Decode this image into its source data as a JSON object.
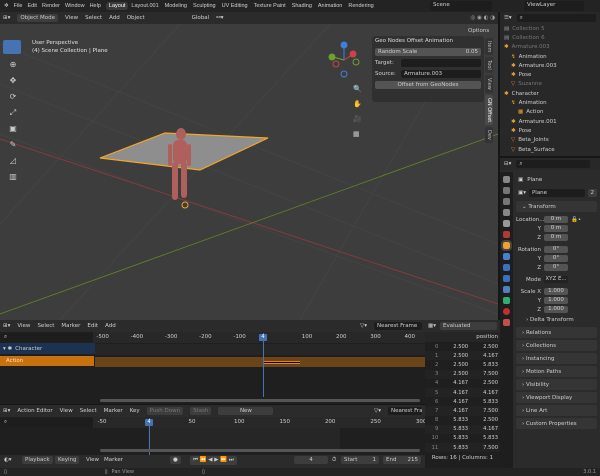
{
  "menu": {
    "items": [
      "File",
      "Edit",
      "Render",
      "Window",
      "Help"
    ],
    "workspaces": [
      "Layout",
      "Layout.001",
      "Modeling",
      "Sculpting",
      "UV Editing",
      "Texture Paint",
      "Shading",
      "Animation",
      "Rendering"
    ],
    "active": "Layout",
    "scene": "Scene",
    "view_layer": "ViewLayer"
  },
  "viewport": {
    "mode": "Object Mode",
    "menus": [
      "View",
      "Select",
      "Add",
      "Object"
    ],
    "orientation": "Global",
    "options": "Options",
    "info_line1": "User Perspective",
    "info_line2": "(4) Scene Collection | Plane",
    "gizmo_axes": [
      "Z",
      "Y",
      "X"
    ]
  },
  "npanel": {
    "title": "Geo Nodes Offset Animation",
    "field_label": "Random Scale",
    "field_value": "0.05",
    "target_label": "Target:",
    "target_value": "",
    "source_label": "Source:",
    "source_value": "Armature.003",
    "button": "Offset from GeoNodes",
    "tabs": [
      "Item",
      "Tool",
      "View",
      "GN Offset",
      "Dev"
    ],
    "active_tab": "GN Offset"
  },
  "outliner": {
    "items": [
      {
        "label": "Collection 5",
        "indent": 0,
        "dim": true
      },
      {
        "label": "Collection 6",
        "indent": 0,
        "dim": true
      },
      {
        "label": "Armature.003",
        "indent": 0,
        "dim": true
      },
      {
        "label": "Animation",
        "indent": 1
      },
      {
        "label": "Armature.003",
        "indent": 1
      },
      {
        "label": "Pose",
        "indent": 1
      },
      {
        "label": "Suzanne",
        "indent": 1,
        "dim": true
      },
      {
        "label": "Character",
        "indent": 0
      },
      {
        "label": "Animation",
        "indent": 1
      },
      {
        "label": "Action",
        "indent": 2
      },
      {
        "label": "Armature.001",
        "indent": 1
      },
      {
        "label": "Pose",
        "indent": 1
      },
      {
        "label": "Beta_Joints",
        "indent": 1
      },
      {
        "label": "Beta_Surface",
        "indent": 1
      }
    ]
  },
  "properties": {
    "object_name": "Plane",
    "data_name": "Plane",
    "users": "2",
    "transform": "Transform",
    "location": {
      "label": "Location...",
      "x": "0 m",
      "y": "0 m",
      "z": "0 m"
    },
    "rotation": {
      "label": "Rotation",
      "x": "0°",
      "y": "0°",
      "z": "0°"
    },
    "mode": {
      "label": "Mode",
      "value": "XYZ E..."
    },
    "scale": {
      "label": "Scale X",
      "x": "1.000",
      "y": "1.000",
      "z": "1.000"
    },
    "axis": {
      "y": "Y",
      "z": "Z"
    },
    "delta": "Delta Transform",
    "sections": [
      "Relations",
      "Collections",
      "Instancing",
      "Motion Paths",
      "Visibility",
      "Viewport Display",
      "Line Art",
      "Custom Properties"
    ]
  },
  "nla": {
    "menus": [
      "View",
      "Select",
      "Marker",
      "Edit",
      "Add"
    ],
    "snap": "Nearest Frame",
    "ticks": [
      "-500",
      "-400",
      "-300",
      "-200",
      "-100",
      "100",
      "200",
      "300",
      "400"
    ],
    "current_frame": "4",
    "tracks": [
      "Character",
      "Action"
    ]
  },
  "action_editor": {
    "mode": "Action Editor",
    "menus": [
      "View",
      "Select",
      "Marker",
      "Key"
    ],
    "push_down": "Push Down",
    "stash": "Stash",
    "new": "New",
    "snap": "Nearest Fram",
    "ticks": [
      "-50",
      "50",
      "100",
      "150",
      "200",
      "250",
      "300"
    ],
    "current_frame": "4"
  },
  "spreadsheet": {
    "mode": "Evaluated",
    "column": "position",
    "rows": [
      [
        "0",
        "2.500",
        "2.500"
      ],
      [
        "1",
        "2.500",
        "4.167"
      ],
      [
        "2",
        "2.500",
        "5.833"
      ],
      [
        "3",
        "2.500",
        "7.500"
      ],
      [
        "4",
        "4.167",
        "2.500"
      ],
      [
        "5",
        "4.167",
        "4.167"
      ],
      [
        "6",
        "4.167",
        "5.833"
      ],
      [
        "7",
        "4.167",
        "7.500"
      ],
      [
        "8",
        "5.833",
        "2.500"
      ],
      [
        "9",
        "5.833",
        "4.167"
      ],
      [
        "10",
        "5.833",
        "5.833"
      ],
      [
        "11",
        "5.833",
        "7.500"
      ]
    ],
    "footer": "Rows: 16  |  Columns: 1"
  },
  "timeline": {
    "menus": [
      "Playback",
      "Keying",
      "View",
      "Marker"
    ],
    "frame": "4",
    "start_label": "Start",
    "start": "1",
    "end_label": "End",
    "end": "215"
  },
  "status": {
    "hint": "Pan View",
    "version": "3.0.1"
  },
  "colors": {
    "accent": "#4772b3",
    "selected": "#f5a623",
    "action_strip": "#d07a10"
  }
}
